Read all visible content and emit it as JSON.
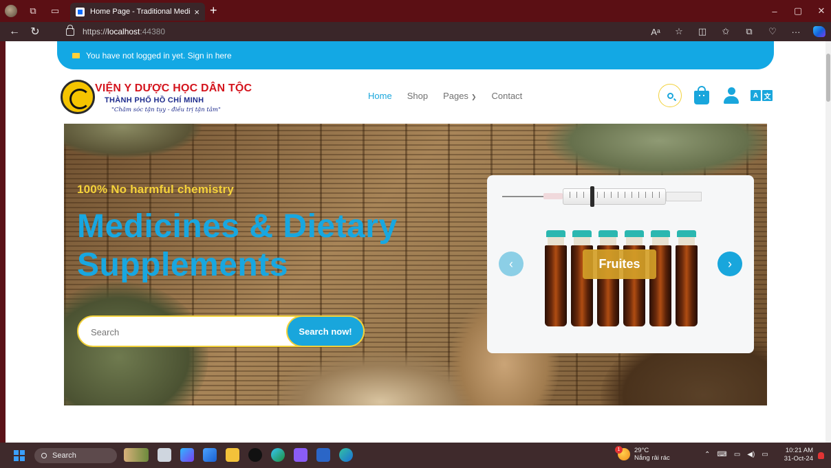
{
  "browser": {
    "tab_title": "Home Page - Traditional Medicine",
    "tab_close": "×",
    "new_tab": "+",
    "url_scheme": "https://",
    "url_host": "localhost",
    "url_port": ":44380",
    "back_icon": "back-arrow-icon",
    "reload_icon": "reload-icon",
    "toolbar_icons": [
      "read-aloud-icon",
      "favorite-star-icon",
      "split-screen-icon",
      "favorites-icon",
      "collections-icon",
      "browser-essentials-icon",
      "more-icon",
      "copilot-icon"
    ],
    "window_controls": {
      "minimize": "–",
      "restore": "▢",
      "close": "✕"
    }
  },
  "site": {
    "login_banner": "You have not logged in yet. Sign in here",
    "logo": {
      "title": "VIỆN Y DƯỢC HỌC DÂN TỘC",
      "subtitle": "THÀNH PHỐ HỒ CHÍ MINH",
      "slogan": "\"Chăm sóc tận tụy - điều trị tận tâm\""
    },
    "nav": {
      "home": "Home",
      "shop": "Shop",
      "pages": "Pages",
      "contact": "Contact"
    },
    "header_icons": [
      "search-icon",
      "shopping-bag-icon",
      "user-icon",
      "translate-icon"
    ],
    "translate_label": {
      "a": "A",
      "b": "文"
    }
  },
  "hero": {
    "tagline": "100% No harmful chemistry",
    "title_line1": "Medicines & Dietary",
    "title_line2": "Supplements",
    "search_placeholder": "Search",
    "search_button": "Search now!",
    "carousel": {
      "slide_label": "Fruites",
      "prev": "‹",
      "next": "›"
    }
  },
  "taskbar": {
    "search_label": "Search",
    "weather_temp": "29°C",
    "weather_desc": "Nắng rải rác",
    "weather_badge": "1",
    "time": "10:21 AM",
    "date": "31-Oct-24"
  },
  "colors": {
    "accent": "#19a6dc",
    "highlight": "#f5d23a",
    "brand_red": "#d4141d",
    "brand_blue": "#1d2b8c",
    "browser_frame": "#5b0f14"
  }
}
